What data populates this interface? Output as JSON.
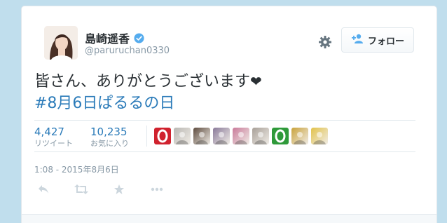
{
  "tweet": {
    "display_name": "島崎遥香",
    "handle": "@paruruchan0330",
    "text": "皆さん、ありがとうございます",
    "hashtag": "#8月6日ぱるるの日",
    "timestamp": "1:08 - 2015年8月6日"
  },
  "follow": {
    "label": "フォロー"
  },
  "stats": {
    "retweets": {
      "count": "4,427",
      "label": "リツイート"
    },
    "favorites": {
      "count": "10,235",
      "label": "お気に入り"
    }
  },
  "likers": [
    {
      "color": "#d0222e",
      "icon": "red-ring-avatar"
    },
    {
      "color": "#b9b7b3",
      "icon": "photo-avatar"
    },
    {
      "color": "#5d4b3e",
      "icon": "photo-avatar"
    },
    {
      "color": "#8a7a9a",
      "icon": "photo-avatar"
    },
    {
      "color": "#c97a9a",
      "icon": "photo-avatar"
    },
    {
      "color": "#a8a098",
      "icon": "photo-avatar"
    },
    {
      "color": "#2f9a3a",
      "icon": "green-ring-avatar"
    },
    {
      "color": "#c9a23a",
      "icon": "photo-avatar"
    },
    {
      "color": "#e2c24a",
      "icon": "photo-avatar"
    }
  ],
  "colors": {
    "accent": "#2b7bb9",
    "verified": "#55acee",
    "muted": "#8899a6",
    "text": "#292f33"
  }
}
